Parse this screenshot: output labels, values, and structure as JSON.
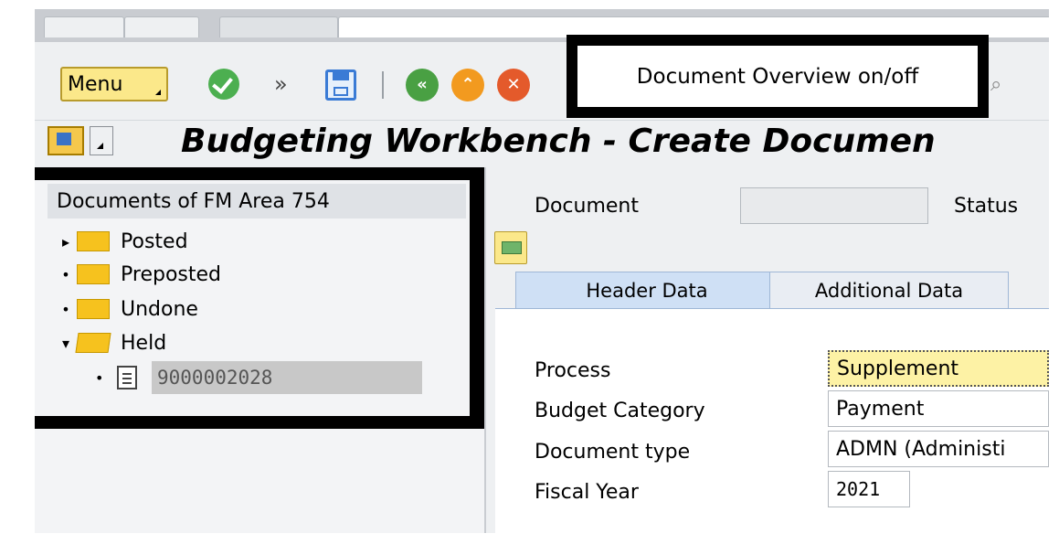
{
  "toolbar": {
    "menu_label": "Menu",
    "overview_toggle_label": "Document Overview on/off"
  },
  "title": "Budgeting Workbench - Create Documen",
  "tree": {
    "header": "Documents of FM Area 754",
    "items": [
      {
        "label": "Posted",
        "expanded": false
      },
      {
        "label": "Preposted",
        "expanded": false
      },
      {
        "label": "Undone",
        "expanded": false
      },
      {
        "label": "Held",
        "expanded": true
      }
    ],
    "held_document": "9000002028"
  },
  "header_fields": {
    "document_label": "Document",
    "document_value": "",
    "status_label": "Status"
  },
  "tabs": [
    {
      "label": "Header Data",
      "active": true
    },
    {
      "label": "Additional Data",
      "active": false
    }
  ],
  "form": {
    "process_label": "Process",
    "process_value": "Supplement",
    "budget_category_label": "Budget Category",
    "budget_category_value": "Payment",
    "document_type_label": "Document type",
    "document_type_value": "ADMN (Administi",
    "fiscal_year_label": "Fiscal Year",
    "fiscal_year_value": "2021"
  },
  "icons": {
    "confirm": "check-circle-icon",
    "more": "double-chevron-right-icon",
    "save": "floppy-disk-icon",
    "back": "back-icon",
    "exit": "exit-icon",
    "cancel": "cancel-icon",
    "other": "glasses-icon"
  },
  "colors": {
    "menu_button": "#fbe88a",
    "active_tab": "#cfe0f5",
    "focused_input": "#fdf2a5",
    "folder": "#f6c21e"
  }
}
